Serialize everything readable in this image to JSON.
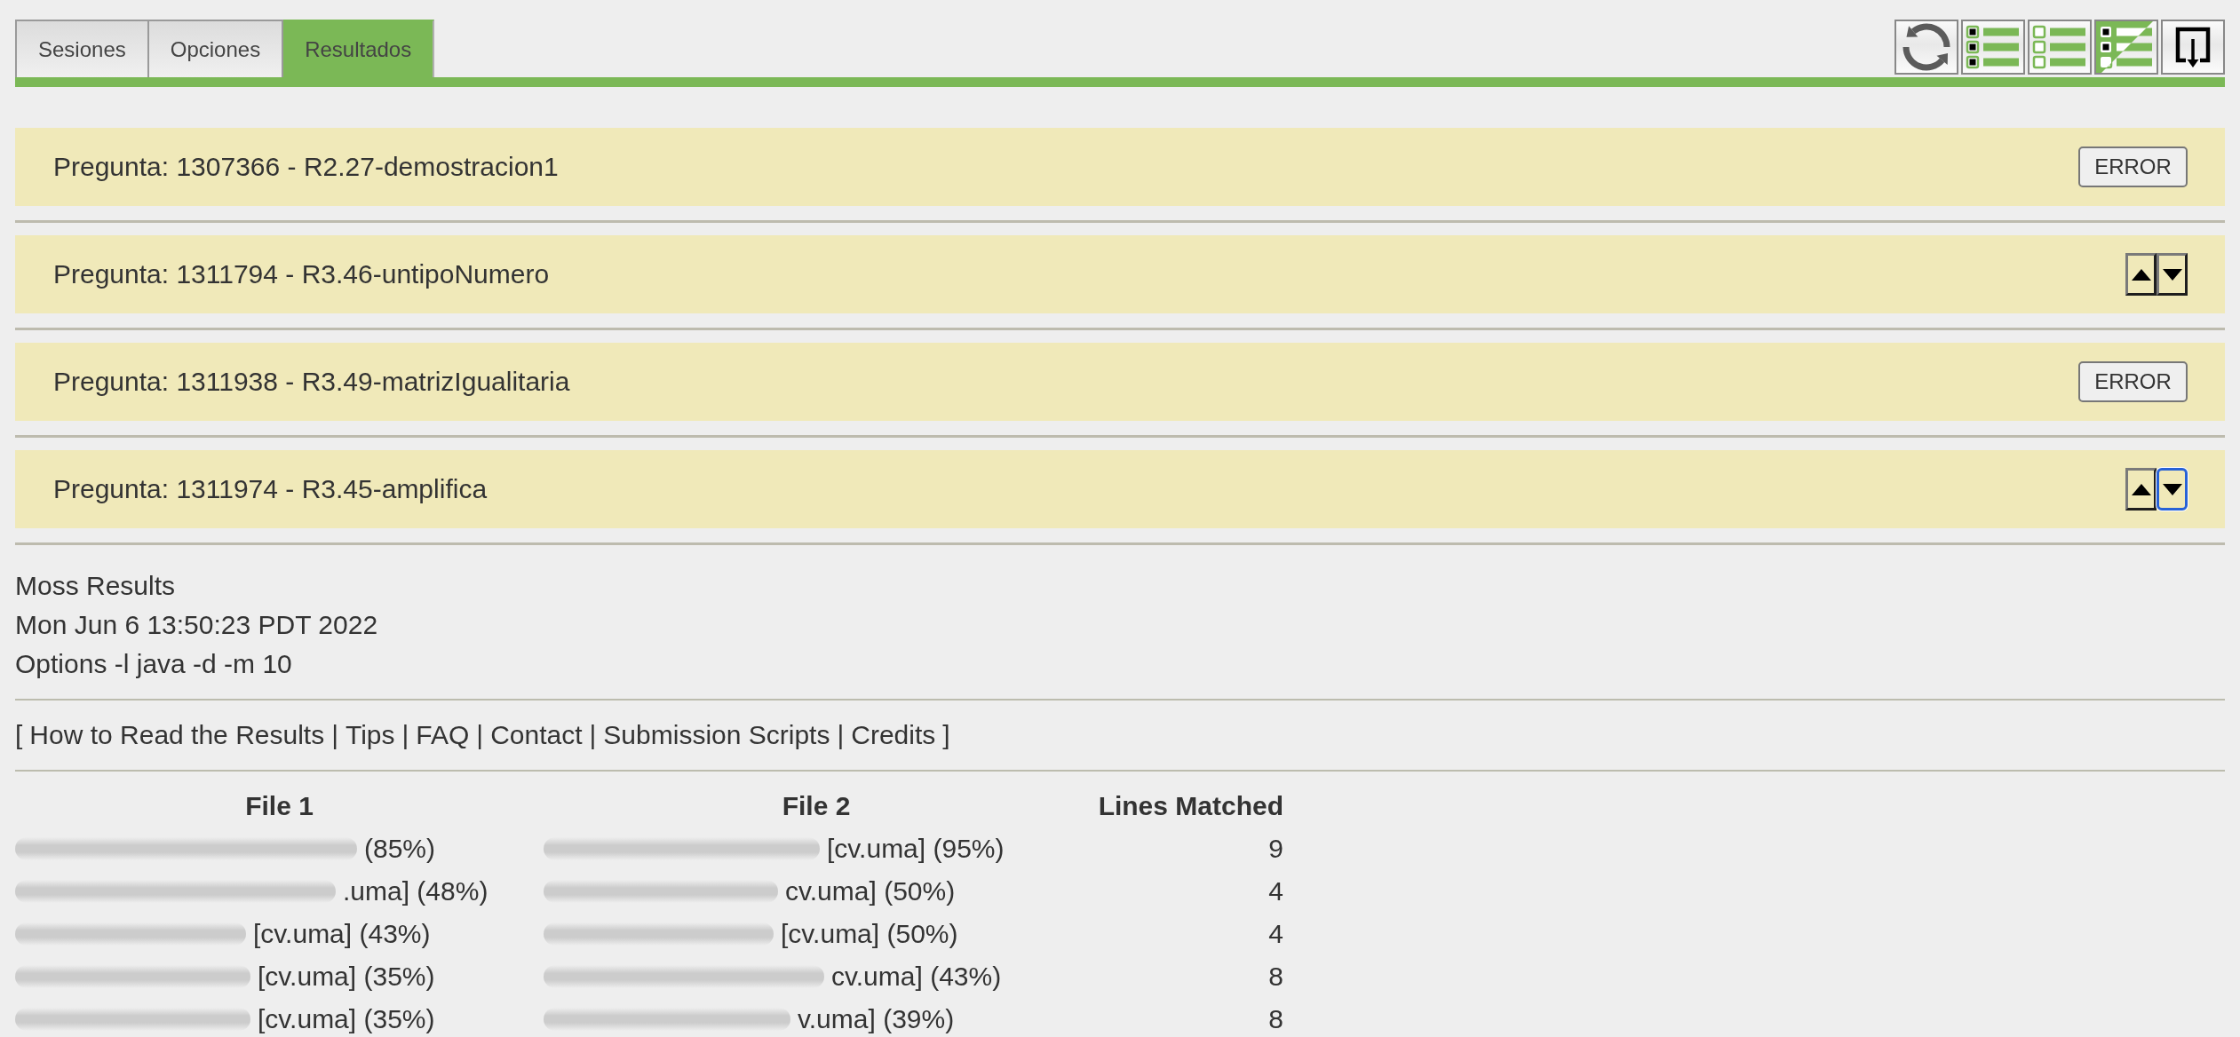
{
  "tabs": [
    {
      "label": "Sesiones",
      "selected": false
    },
    {
      "label": "Opciones",
      "selected": false
    },
    {
      "label": "Resultados",
      "selected": true
    }
  ],
  "questions": [
    {
      "title": "Pregunta: 1307366 - R2.27-demostracion1",
      "kind": "error",
      "button": "ERROR"
    },
    {
      "title": "Pregunta: 1311794 - R3.46-untipoNumero",
      "kind": "arrows",
      "arrows": [
        {
          "kind": "up",
          "focused": false
        },
        {
          "kind": "down",
          "focused": false
        }
      ]
    },
    {
      "title": "Pregunta: 1311938 - R3.49-matrizIgualitaria",
      "kind": "error",
      "button": "ERROR"
    },
    {
      "title": "Pregunta: 1311974 - R3.45-amplifica",
      "kind": "arrows",
      "arrows": [
        {
          "kind": "up",
          "focused": false
        },
        {
          "kind": "down",
          "focused": true
        }
      ]
    }
  ],
  "moss": {
    "header_lines": [
      "Moss Results",
      "Mon Jun 6 13:50:23 PDT 2022",
      "Options -l java -d -m 10"
    ],
    "links_bar": {
      "open": "[",
      "items": [
        {
          "link": "How to Read the Results",
          "separator": "|"
        },
        {
          "link": "Tips",
          "separator": "|"
        },
        {
          "link": "FAQ",
          "separator": "|"
        },
        {
          "link": "Contact",
          "separator": "|"
        },
        {
          "link": "Submission Scripts",
          "separator": "|"
        },
        {
          "link": "Credits"
        }
      ],
      "close": "]"
    }
  },
  "table": {
    "columns": [
      "File 1",
      "File 2",
      "Lines Matched"
    ],
    "rows": [
      {
        "file_1": {
          "redacted": true,
          "text": "(85%)"
        },
        "file_2": {
          "redacted": true,
          "text": "[cv.uma] (95%)"
        },
        "lines_matched": "9"
      },
      {
        "file_1": {
          "redacted": true,
          "text": ".uma] (48%)"
        },
        "file_2": {
          "redacted": true,
          "text": "cv.uma] (50%)"
        },
        "lines_matched": "4"
      },
      {
        "file_1": {
          "redacted": true,
          "text": "[cv.uma] (43%)"
        },
        "file_2": {
          "redacted": true,
          "text": "[cv.uma] (50%)"
        },
        "lines_matched": "4"
      },
      {
        "file_1": {
          "redacted": true,
          "text": "[cv.uma] (35%)"
        },
        "file_2": {
          "redacted": true,
          "text": "cv.uma] (43%)"
        },
        "lines_matched": "8"
      },
      {
        "file_1": {
          "redacted": true,
          "text": "[cv.uma] (35%)"
        },
        "file_2": {
          "redacted": true,
          "text": "v.uma] (39%)"
        },
        "lines_matched": "8"
      }
    ]
  }
}
